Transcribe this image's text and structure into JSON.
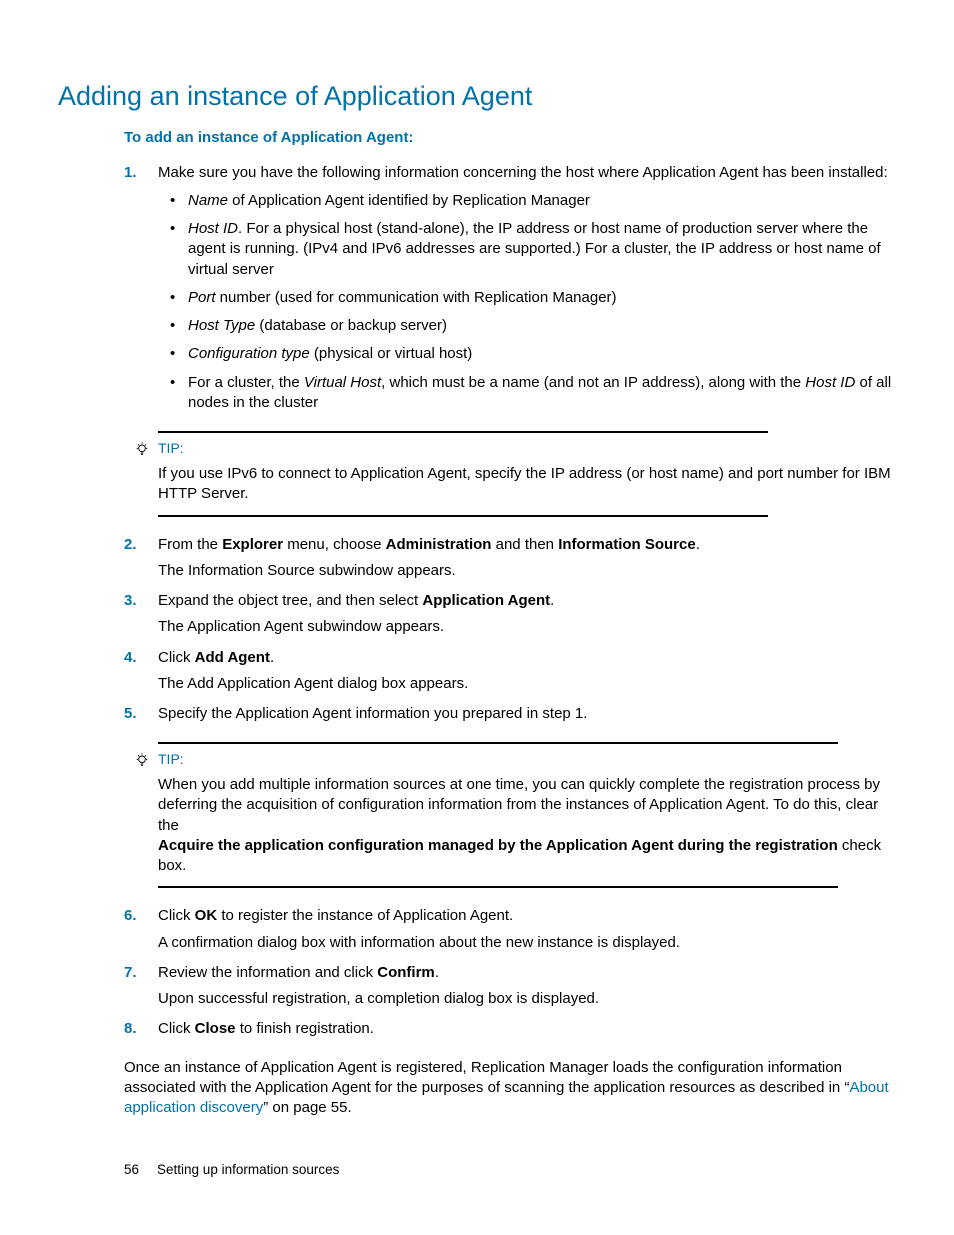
{
  "title": "Adding an instance of Application Agent",
  "subheading": "To add an instance of Application Agent:",
  "steps": [
    {
      "num": "1.",
      "text": "Make sure you have the following information concerning the host where Application Agent has been installed:",
      "bullets": [
        {
          "pre_italic": "Name",
          "post": " of Application Agent identified by Replication Manager"
        },
        {
          "pre_italic": "Host ID",
          "post": ". For a physical host (stand-alone), the IP address or host name of production server where the agent is running. (IPv4 and IPv6 addresses are supported.) For a cluster, the IP address or host name of virtual server"
        },
        {
          "pre_italic": "Port",
          "post": " number (used for communication with Replication Manager)"
        },
        {
          "pre_italic": "Host Type",
          "post": " (database or backup server)"
        },
        {
          "pre_italic": "Configuration type",
          "post": " (physical or virtual host)"
        },
        {
          "plain_pre": "For a cluster, the ",
          "italic1": "Virtual Host",
          "plain_mid": ", which must be a name (and not an IP address), along with the ",
          "italic2": "Host ID",
          "plain_post": " of all nodes in the cluster"
        }
      ]
    },
    {
      "num": "2.",
      "parts": {
        "a": "From the ",
        "b": "Explorer",
        "c": " menu, choose ",
        "d": "Administration",
        "e": " and then ",
        "f": "Information Source",
        "g": "."
      },
      "follow": "The Information Source subwindow appears."
    },
    {
      "num": "3.",
      "parts": {
        "a": "Expand the object tree, and then select ",
        "b": "Application Agent",
        "c": "."
      },
      "follow": "The Application Agent subwindow appears."
    },
    {
      "num": "4.",
      "parts": {
        "a": "Click ",
        "b": "Add Agent",
        "c": "."
      },
      "follow": "The Add Application Agent dialog box appears."
    },
    {
      "num": "5.",
      "text": "Specify the Application Agent information you prepared in step 1."
    },
    {
      "num": "6.",
      "parts": {
        "a": "Click ",
        "b": "OK",
        "c": " to register the instance of Application Agent."
      },
      "follow": "A confirmation dialog box with information about the new instance is displayed."
    },
    {
      "num": "7.",
      "parts": {
        "a": "Review the information and click ",
        "b": "Confirm",
        "c": "."
      },
      "follow": "Upon successful registration, a completion dialog box is displayed."
    },
    {
      "num": "8.",
      "parts": {
        "a": "Click ",
        "b": "Close",
        "c": " to finish registration."
      }
    }
  ],
  "tip1": {
    "label": "TIP:",
    "body": "If you use IPv6 to connect to Application Agent, specify the IP address (or host name) and port number for IBM HTTP Server."
  },
  "tip2": {
    "label": "TIP:",
    "body_pre": "When you add multiple information sources at one time, you can quickly complete the registration process by deferring the acquisition of configuration information from the instances of Application Agent. To do this, clear the",
    "body_bold": "Acquire the application configuration managed by the Application Agent during the registration",
    "body_post": " check box."
  },
  "closing": {
    "pre": "Once an instance of Application Agent is registered, Replication Manager loads the configuration information associated with the Application Agent for the purposes of scanning the application resources as described in “",
    "link": "About application discovery",
    "post": "” on page 55."
  },
  "footer": {
    "page": "56",
    "section": "Setting up information sources"
  }
}
